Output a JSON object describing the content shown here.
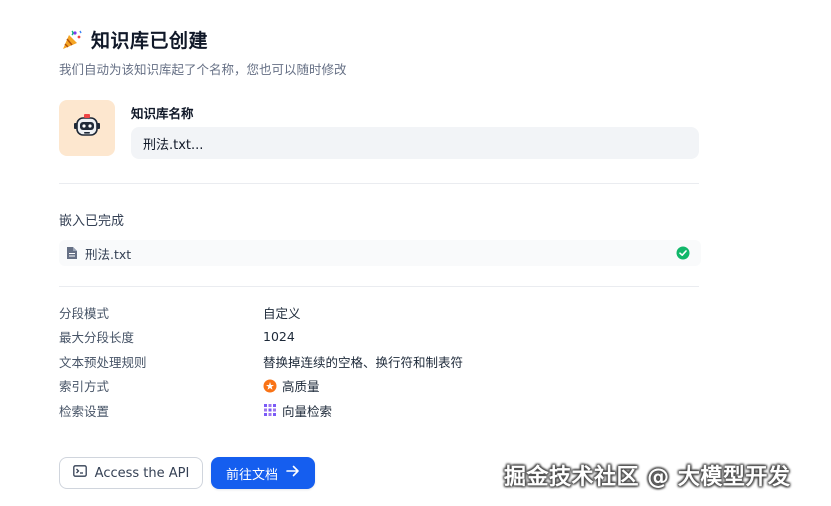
{
  "header": {
    "title": "知识库已创建",
    "subtitle": "我们自动为该知识库起了个名称，您也可以随时修改",
    "icon": "party-popper-icon"
  },
  "knowledge_base": {
    "name_label": "知识库名称",
    "name_value": "刑法.txt...",
    "avatar_icon": "robot-icon",
    "avatar_bg": "#fde7cf"
  },
  "embedding": {
    "title": "嵌入已完成",
    "files": [
      {
        "name": "刑法.txt",
        "icon": "document-icon",
        "status_icon": "check-circle-icon",
        "status_color": "#12b76a"
      }
    ]
  },
  "settings": [
    {
      "label": "分段模式",
      "value": "自定义"
    },
    {
      "label": "最大分段长度",
      "value": "1024"
    },
    {
      "label": "文本预处理规则",
      "value": "替换掉连续的空格、换行符和制表符"
    },
    {
      "label": "索引方式",
      "value": "高质量",
      "icon": "star-badge-icon"
    },
    {
      "label": "检索设置",
      "value": "向量检索",
      "icon": "vector-grid-icon"
    }
  ],
  "actions": {
    "api_label": "Access the API",
    "docs_label": "前往文档",
    "primary_color": "#155eef"
  },
  "watermark": "掘金技术社区 @ 大模型开发"
}
